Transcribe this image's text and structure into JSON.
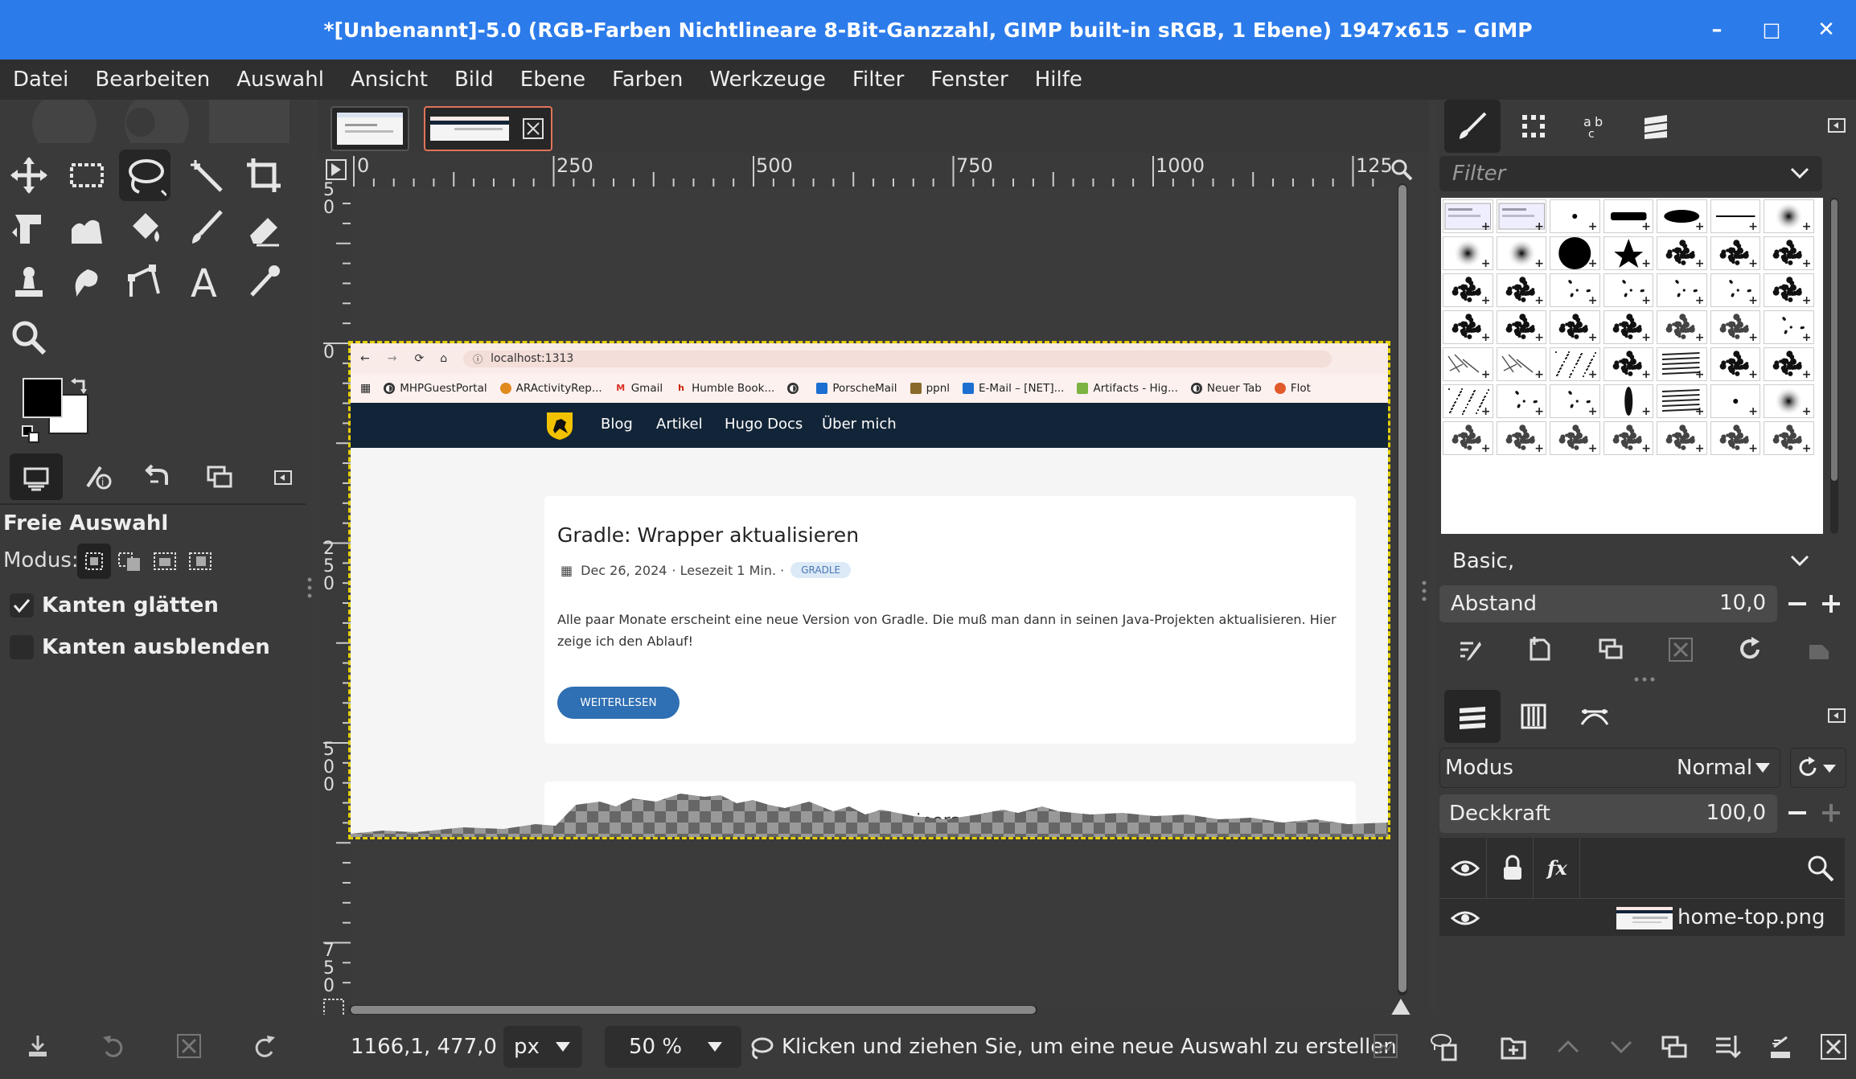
{
  "window": {
    "title": "*[Unbenannt]-5.0 (RGB-Farben Nichtlineare 8-Bit-Ganzzahl, GIMP built-in sRGB, 1 Ebene) 1947x615 – GIMP",
    "minimize": "–",
    "maximize": "□",
    "close": "✕"
  },
  "menu": [
    "Datei",
    "Bearbeiten",
    "Auswahl",
    "Ansicht",
    "Bild",
    "Ebene",
    "Farben",
    "Werkzeuge",
    "Filter",
    "Fenster",
    "Hilfe"
  ],
  "tool_options": {
    "title": "Freie Auswahl",
    "mode_label": "Modus:",
    "antialias_label": "Kanten glätten",
    "antialias_checked": true,
    "feather_label": "Kanten ausblenden",
    "feather_checked": false
  },
  "hruler": {
    "ticks": [
      "0",
      "250",
      "500",
      "750",
      "1000",
      "125"
    ]
  },
  "vruler": {
    "ticks": [
      {
        "digits": [
          "5",
          "0"
        ]
      },
      {
        "digits": [
          "0"
        ]
      },
      {
        "digits": [
          "2",
          "5",
          "0"
        ]
      },
      {
        "digits": [
          "5",
          "0",
          "0"
        ]
      },
      {
        "digits": [
          "7",
          "5",
          "0"
        ]
      }
    ]
  },
  "webpage": {
    "url": "localhost:1313",
    "bookmarks": [
      {
        "label": "MHPGuestPortal",
        "color": "#333"
      },
      {
        "label": "ARActivityRep...",
        "color": "#e08a1e"
      },
      {
        "label": "Gmail",
        "color": "#d93025"
      },
      {
        "label": "Humble Book...",
        "color": "#cc2200"
      },
      {
        "label": "",
        "color": "#333"
      },
      {
        "label": "PorscheMail",
        "color": "#1a6fd1"
      },
      {
        "label": "ppnl",
        "color": "#8a6a2a"
      },
      {
        "label": "E-Mail – [NET]...",
        "color": "#1a6fd1"
      },
      {
        "label": "Artifacts - Hig...",
        "color": "#7cb342"
      },
      {
        "label": "Neuer Tab",
        "color": "#333"
      },
      {
        "label": "Flot",
        "color": "#e2592c"
      }
    ],
    "nav": [
      "Blog",
      "Artikel",
      "Hugo Docs",
      "Über mich"
    ],
    "post": {
      "title": "Gradle: Wrapper aktualisieren",
      "date": "Dec 26, 2024",
      "readtime": "· Lesezeit 1 Min. ·",
      "tag": "GRADLE",
      "excerpt_line1": "Alle paar Monate erscheint eine neue Version von Gradle. Die muß man dann in seinen Java-Projekten aktualisieren. Hier",
      "excerpt_line2": "zeige ich den Ablauf!",
      "button": "WEITERLESEN"
    },
    "second_card_fragment": "tainers mit"
  },
  "brushes": {
    "filter_placeholder": "Filter",
    "preset": "Basic,",
    "spacing_label": "Abstand",
    "spacing_value": "10,0"
  },
  "layers": {
    "mode_label": "Modus",
    "mode_value": "Normal",
    "opacity_label": "Deckkraft",
    "opacity_value": "100,0",
    "items": [
      {
        "name": "home-top.png",
        "visible": true
      }
    ]
  },
  "status": {
    "coords": "1166,1, 477,0",
    "unit": "px",
    "zoom": "50 %",
    "message": "Klicken und ziehen Sie, um eine neue Auswahl zu erstellen"
  },
  "colors": {
    "titlebar": "#2c7bea",
    "site_header": "#122437",
    "tag_bg": "#dce9f7",
    "button_bg": "#2f6fb3",
    "selection": "#e6d000"
  }
}
